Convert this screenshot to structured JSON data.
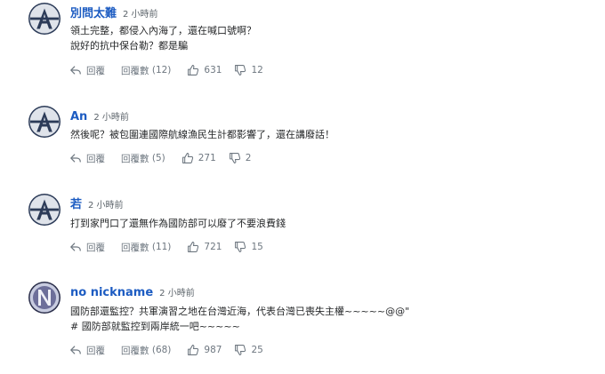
{
  "labels": {
    "reply": "回覆",
    "replies": "回覆數"
  },
  "icons": {
    "reply": "reply-arrow-icon",
    "like": "thumbs-up-icon",
    "dislike": "thumbs-down-icon"
  },
  "comments": [
    {
      "username": "別問太難",
      "time": "2 小時前",
      "lines": [
        "領土完整，都侵入內海了，還在喊口號啊？",
        "說好的抗中保台勒？都是騙"
      ],
      "reply_count": "(12)",
      "likes": "631",
      "dislikes": "12",
      "avatar": "letter-a-avatar"
    },
    {
      "username": "An",
      "time": "2 小時前",
      "lines": [
        "然後呢？被包圍連國際航線漁民生計都影響了，還在講廢話！"
      ],
      "reply_count": "(5)",
      "likes": "271",
      "dislikes": "2",
      "avatar": "letter-a-avatar"
    },
    {
      "username": "若",
      "time": "2 小時前",
      "lines": [
        "打到家門口了還無作為國防部可以廢了不要浪費錢"
      ],
      "reply_count": "(11)",
      "likes": "721",
      "dislikes": "15",
      "avatar": "letter-a-avatar"
    },
    {
      "username": "no nickname",
      "time": "2 小時前",
      "lines": [
        "國防部還監控？共軍演習之地在台灣近海，代表台灣已喪失主權~~~~~@@\"",
        "# 國防部就監控到兩岸統一吧~~~~~"
      ],
      "reply_count": "(68)",
      "likes": "987",
      "dislikes": "25",
      "avatar": "letter-n-avatar"
    }
  ]
}
